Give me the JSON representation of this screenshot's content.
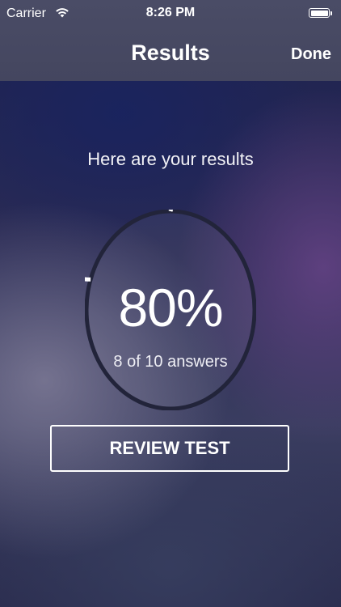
{
  "status_bar": {
    "carrier": "Carrier",
    "time": "8:26 PM",
    "icons": [
      "wifi-icon",
      "battery-icon"
    ]
  },
  "nav": {
    "title": "Results",
    "done_label": "Done"
  },
  "results": {
    "subtitle": "Here are your results",
    "percent_text": "80%",
    "answers_text": "8 of 10 answers",
    "score_fraction": 0.8
  },
  "actions": {
    "review_label": "REVIEW TEST"
  },
  "colors": {
    "ring_filled": "#ffffff",
    "ring_track": "#22243a",
    "nav_background": "#48495f"
  }
}
